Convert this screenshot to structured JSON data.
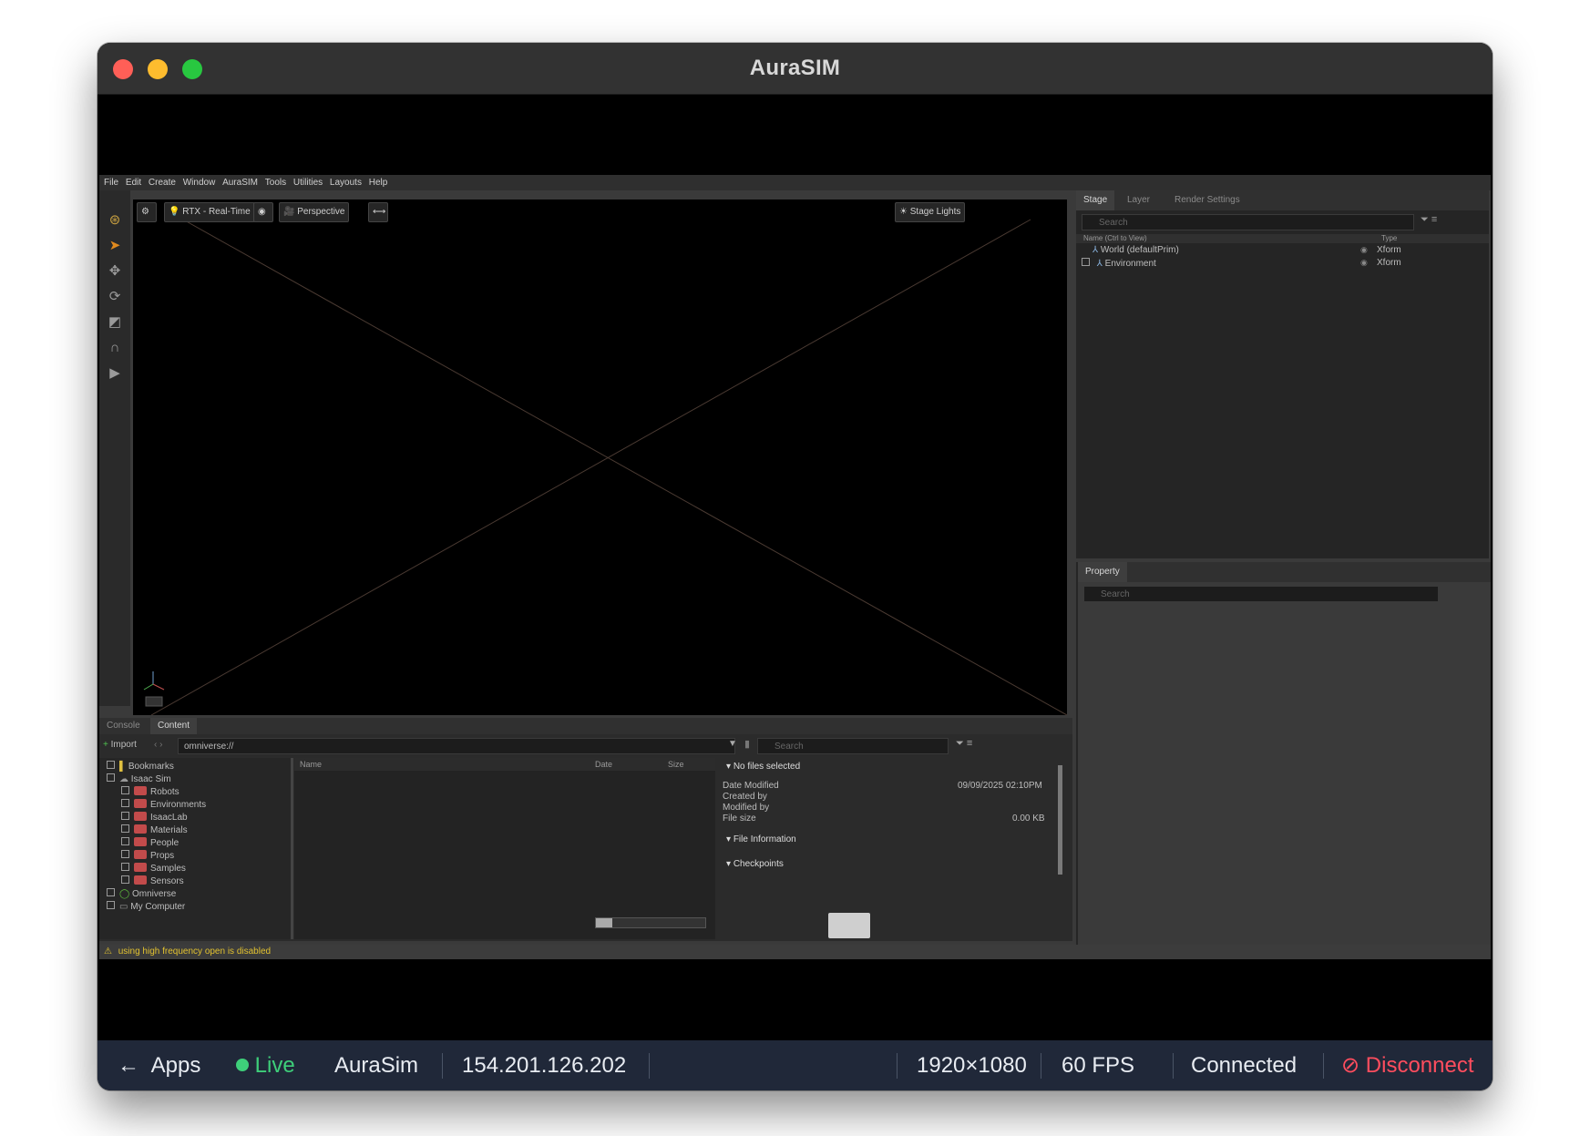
{
  "window": {
    "title": "AuraSIM",
    "traffic_lights": {
      "close": "#ff5f57",
      "minimize": "#febc2e",
      "zoom": "#28c840"
    }
  },
  "menubar": [
    "File",
    "Edit",
    "Create",
    "Window",
    "AuraSIM",
    "Tools",
    "Utilities",
    "Layouts",
    "Help"
  ],
  "viewport_toolbar": {
    "renderer": "RTX - Real-Time",
    "camera": "Perspective",
    "stage_lights": "Stage Lights"
  },
  "stage_panel": {
    "tabs": [
      "Stage",
      "Layer",
      "Render Settings"
    ],
    "search_placeholder": "Search",
    "columns": {
      "name": "Name (Ctrl to View)",
      "type": "Type"
    },
    "rows": [
      {
        "name": "World (defaultPrim)",
        "type": "Xform"
      },
      {
        "name": "Environment",
        "type": "Xform"
      }
    ]
  },
  "property_panel": {
    "tab": "Property",
    "search_placeholder": "Search"
  },
  "bottom_panel": {
    "tabs": [
      "Console",
      "Content"
    ],
    "import_label": "Import",
    "path": "omniverse://",
    "search_placeholder": "Search",
    "tree": [
      {
        "label": "Bookmarks",
        "indent": 0
      },
      {
        "label": "Isaac Sim",
        "indent": 0
      },
      {
        "label": "Robots",
        "indent": 1
      },
      {
        "label": "Environments",
        "indent": 1
      },
      {
        "label": "IsaacLab",
        "indent": 1
      },
      {
        "label": "Materials",
        "indent": 1
      },
      {
        "label": "People",
        "indent": 1
      },
      {
        "label": "Props",
        "indent": 1
      },
      {
        "label": "Samples",
        "indent": 1
      },
      {
        "label": "Sensors",
        "indent": 1
      },
      {
        "label": "Omniverse",
        "indent": 0
      },
      {
        "label": "My Computer",
        "indent": 0
      }
    ],
    "file_columns": {
      "name": "Name",
      "date": "Date",
      "size": "Size"
    },
    "details": {
      "header": "No files selected",
      "date_modified_label": "Date Modified",
      "date_modified_value": "09/09/2025 02:10PM",
      "created_by_label": "Created by",
      "modified_by_label": "Modified by",
      "file_size_label": "File size",
      "file_size_value": "0.00 KB",
      "file_information": "File Information",
      "checkpoints": "Checkpoints"
    }
  },
  "warning": "using high frequency open is disabled",
  "statusbar": {
    "apps": "Apps",
    "live": "Live",
    "app_name": "AuraSim",
    "ip": "154.201.126.202",
    "resolution": "1920×1080",
    "fps": "60 FPS",
    "connection": "Connected",
    "disconnect": "Disconnect",
    "live_color": "#3ecf7a",
    "disconnect_color": "#ff4d5e"
  }
}
